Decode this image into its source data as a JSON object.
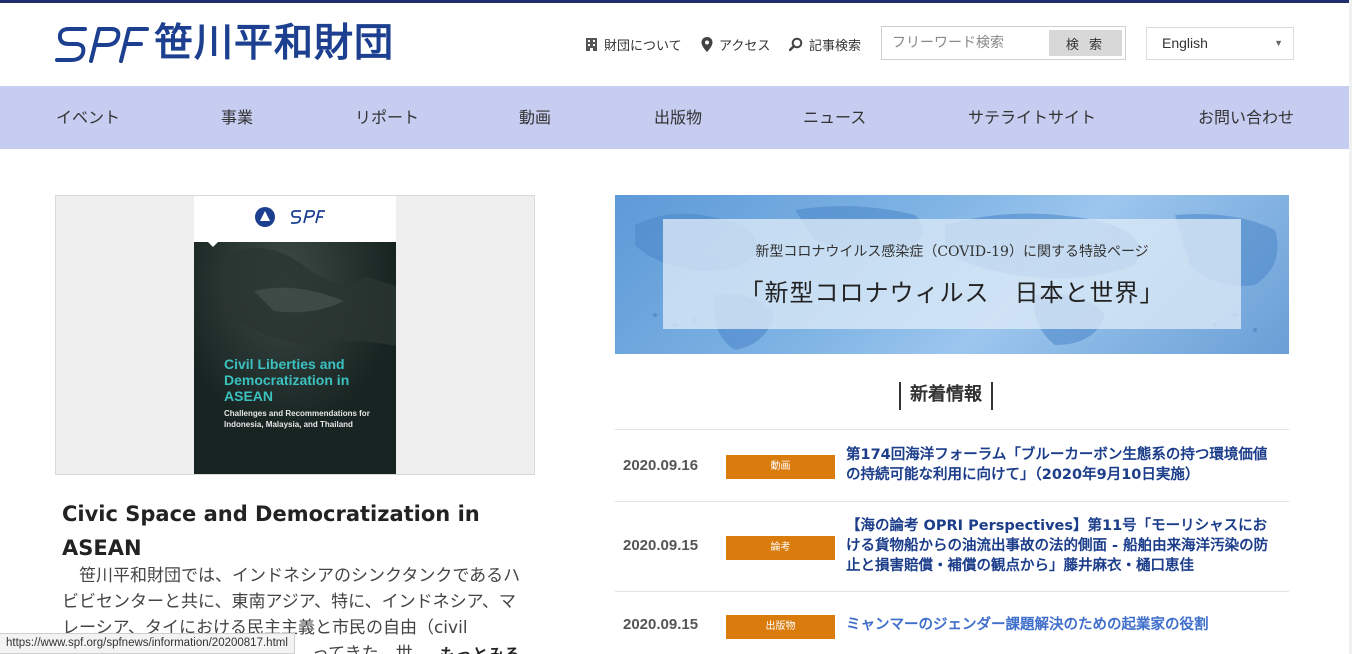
{
  "header": {
    "logo_text": "笹川平和財団",
    "links": [
      {
        "label": "財団について",
        "icon": "building-icon"
      },
      {
        "label": "アクセス",
        "icon": "location-pin-icon"
      },
      {
        "label": "記事検索",
        "icon": "search-icon"
      }
    ],
    "search": {
      "placeholder": "フリーワード検索",
      "button_label": "検 索"
    },
    "language": {
      "selected": "English"
    }
  },
  "nav": {
    "items": [
      "イベント",
      "事業",
      "リポート",
      "動画",
      "出版物",
      "ニュース",
      "サテライトサイト",
      "お問い合わせ"
    ]
  },
  "feature": {
    "book": {
      "title": "Civil Liberties and Democratization in ASEAN",
      "subtitle": "Challenges and Recommendations for Indonesia, Malaysia, and Thailand"
    },
    "title": "Civic Space and Democratization in ASEAN",
    "text": "　笹川平和財団では、インドネシアのシンクタンクであるハビビセンターと共に、東南アジア、特に、インドネシア、マレーシア、タイにおける民主主義と市民の自由（civil",
    "text_tail": "ってきた。世",
    "more_label": "もっとみる"
  },
  "banner": {
    "subtitle": "新型コロナウイルス感染症（COVID-19）に関する特設ページ",
    "title": "「新型コロナウィルス　日本と世界」"
  },
  "news": {
    "heading": "新着情報",
    "tag_color": "#d97c0d",
    "items": [
      {
        "date": "2020.09.16",
        "tag": "動画",
        "title": "第174回海洋フォーラム「ブルーカーボン生態系の持つ環境価値の持続可能な利用に向けて」（2020年9月10日実施）"
      },
      {
        "date": "2020.09.15",
        "tag": "論考",
        "title": "【海の論考 OPRI Perspectives】第11号「モーリシャスにおける貨物船からの油流出事故の法的側面 - 船舶由来海洋汚染の防止と損害賠償・補償の観点から」藤井麻衣・樋口恵佳"
      },
      {
        "date": "2020.09.15",
        "tag": "出版物",
        "title": "ミャンマーのジェンダー課題解決のための起業家の役割"
      }
    ]
  },
  "status_bar": {
    "url": "https://www.spf.org/spfnews/information/20200817.html"
  }
}
